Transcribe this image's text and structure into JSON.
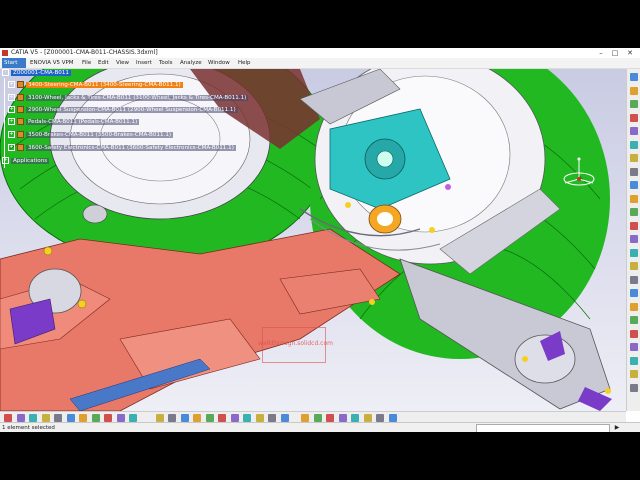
{
  "window": {
    "title": "CATIA V5 - [Z000001-CMA-B011-CHASSIS.3dxml]",
    "minimize_glyph": "–",
    "maximize_glyph": "□",
    "close_glyph": "✕"
  },
  "menubar": {
    "items": [
      "Start",
      "ENOVIA V5 VPM",
      "File",
      "Edit",
      "View",
      "Insert",
      "Tools",
      "Analyze",
      "Window",
      "Help"
    ]
  },
  "tree": {
    "root": "Z000001-CMA-B011",
    "items": [
      {
        "label": "3400-Steering-CMA-B011 (3400-Steering-CMA-B011.1)",
        "state": "selected"
      },
      {
        "label": "3100-Wheel, Jacks & Tires-CMA-B011 (3100-Wheel, Jacks & Tires-CMA-B011.1)",
        "state": "normal"
      },
      {
        "label": "2900-Wheel Suspension-CMA-B011 (2900-Wheel Suspension-CMA-B011.1)",
        "state": "normal"
      },
      {
        "label": "Pedals-CMA-B011 (Pedals-CMA-B011.1)",
        "state": "normal"
      },
      {
        "label": "3500-Brakes-CMA-B011 (3500-Brakes-CMA-B011.1)",
        "state": "normal"
      },
      {
        "label": "3600-Safety Electronics-CMA-B011 (3600-Safety Electronics-CMA-B011.1)",
        "state": "normal"
      }
    ],
    "applications": "Applications"
  },
  "viewport": {
    "watermark": "walkthrough.solidcd.com"
  },
  "statusbar": {
    "text": "1 element selected",
    "run_glyph": "▶"
  },
  "colors": {
    "tire_green": "#22b822",
    "frame_salmon": "#e87868",
    "hub_cyan": "#2ec4c4",
    "rim_white": "#f2f2f6",
    "purple_part": "#7a3cc8",
    "selection_orange": "#f08010",
    "root_blue": "#1e64c8"
  },
  "icons": {
    "right_toolbar": [
      "select-icon",
      "fly-mode-icon",
      "sketch-icon",
      "measure-icon",
      "part-icon",
      "product-icon",
      "constraint-icon",
      "analysis-icon",
      "render-icon",
      "catalog-icon",
      "hide-show-icon",
      "swap-icon",
      "capture-icon",
      "macro-icon",
      "help-icon",
      "compass-icon",
      "light-icon",
      "material-icon",
      "layer-icon",
      "snap-icon",
      "grid-icon",
      "lock-icon",
      "update-icon",
      "catia-logo-icon"
    ],
    "bottom_toolbar": [
      "new-icon",
      "open-icon",
      "save-icon",
      "print-icon",
      "cut-icon",
      "copy-icon",
      "paste-icon",
      "undo-icon",
      "redo-icon",
      "refresh-icon",
      "help-pointer-icon",
      "fit-all-icon",
      "pan-icon",
      "rotate-icon",
      "zoom-in-icon",
      "zoom-out-icon",
      "normal-view-icon",
      "iso-view-icon",
      "shading-icon",
      "hide-icon",
      "swap-visible-icon",
      "render-style-icon",
      "analysis-tool-icon",
      "measure-tool-icon",
      "snapshot-icon",
      "fly-icon",
      "walk-icon",
      "look-at-icon",
      "turn-head-icon",
      "quick-view-icon"
    ]
  }
}
